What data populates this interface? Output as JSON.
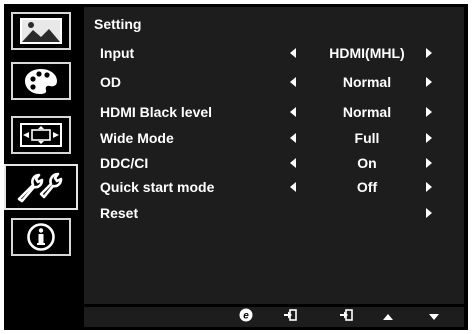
{
  "menu": {
    "title": "Setting",
    "items": [
      {
        "label": "Input",
        "value": "HDMI(MHL)",
        "has_left": true,
        "has_right": true
      },
      {
        "label": "OD",
        "value": "Normal",
        "has_left": true,
        "has_right": true
      },
      {
        "label": "HDMI Black level",
        "value": "Normal",
        "has_left": true,
        "has_right": true
      },
      {
        "label": "Wide Mode",
        "value": "Full",
        "has_left": true,
        "has_right": true
      },
      {
        "label": "DDC/CI",
        "value": "On",
        "has_left": true,
        "has_right": true
      },
      {
        "label": "Quick start mode",
        "value": "Off",
        "has_left": true,
        "has_right": true
      },
      {
        "label": "Reset",
        "value": "",
        "has_left": false,
        "has_right": true
      }
    ]
  },
  "rail": [
    {
      "icon": "picture-icon",
      "selected": false
    },
    {
      "icon": "color-palette-icon",
      "selected": false
    },
    {
      "icon": "osd-position-icon",
      "selected": false
    },
    {
      "icon": "setting-wrench-icon",
      "selected": true
    },
    {
      "icon": "information-icon",
      "selected": false
    }
  ],
  "keys": [
    "e-key-icon",
    "input-key-icon",
    "enter-key-icon",
    "up-arrow-key-icon",
    "down-arrow-key-icon"
  ],
  "colors": {
    "background": "#000000",
    "panel": "#1d1d1d",
    "text": "#ffffff",
    "icon_border": "#d8d8d8"
  }
}
